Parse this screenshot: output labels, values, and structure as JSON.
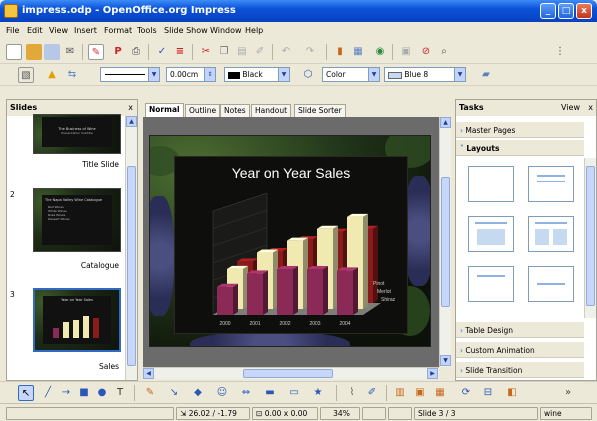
{
  "window": {
    "title": "impress.odp - OpenOffice.org Impress",
    "controls": {
      "minimize": "_",
      "maximize": "□",
      "close": "x"
    }
  },
  "menu": [
    "File",
    "Edit",
    "View",
    "Insert",
    "Format",
    "Tools",
    "Slide Show",
    "Window",
    "Help"
  ],
  "line_toolbar": {
    "line_width": "0.00cm",
    "line_color": "Black",
    "area_style": "Color",
    "area_color": "Blue 8"
  },
  "slides_panel": {
    "title": "Slides",
    "close": "x",
    "slides": [
      {
        "number": "",
        "label": "Title Slide",
        "title_text": "The Business of Wine",
        "subtitle_text": "Presentation Subtitle"
      },
      {
        "number": "2",
        "label": "Catalogue",
        "title_text": "The Napa Valley Wine Catalogue",
        "bullets": [
          "Red Wines",
          "White Wines",
          "Rosé Wines",
          "Dessert Wines"
        ]
      },
      {
        "number": "3",
        "label": "Sales",
        "title_text": "Year on Year Sales"
      }
    ]
  },
  "view_tabs": [
    "Normal",
    "Outline",
    "Notes",
    "Handout",
    "Slide Sorter"
  ],
  "active_view_tab": "Normal",
  "slide": {
    "title": "Year on Year Sales"
  },
  "chart_data": {
    "type": "bar",
    "title": "Year on Year Sales",
    "categories": [
      "2000",
      "2001",
      "2002",
      "2003",
      "2004"
    ],
    "series": [
      {
        "name": "",
        "values": [
          28,
          35,
          43,
          48,
          50
        ],
        "color": "#8b1a1a"
      },
      {
        "name": "",
        "values": [
          27,
          38,
          46,
          54,
          62
        ],
        "color": "#f0eab0"
      },
      {
        "name": "",
        "values": [
          19,
          28,
          31,
          31,
          30
        ],
        "color": "#8b2a57"
      }
    ],
    "ylim": [
      0,
      70
    ],
    "grid": true,
    "legend_placement": "right",
    "legend_entries": [
      "Pinot",
      "Merlot",
      "Shiraz"
    ],
    "xlabel": "",
    "ylabel": ""
  },
  "tasks_panel": {
    "title": "Tasks",
    "view_menu": "View",
    "close": "x",
    "sections": [
      {
        "label": "Master Pages",
        "expanded": false
      },
      {
        "label": "Layouts",
        "expanded": true
      },
      {
        "label": "Table Design",
        "expanded": false
      },
      {
        "label": "Custom Animation",
        "expanded": false
      },
      {
        "label": "Slide Transition",
        "expanded": false
      }
    ]
  },
  "status": {
    "position": "26.02 / -1.79",
    "size": "0.00 x 0.00",
    "zoom": "34%",
    "slide": "Slide 3 / 3",
    "master": "wine"
  },
  "colors": {
    "title_bar": "#0a52d8",
    "chrome": "#ece9d8",
    "slide_background": "#0e0f0d",
    "bar_dark_red": "#8b1a1a",
    "bar_cream": "#f0eab0",
    "bar_plum": "#8b2a57"
  }
}
